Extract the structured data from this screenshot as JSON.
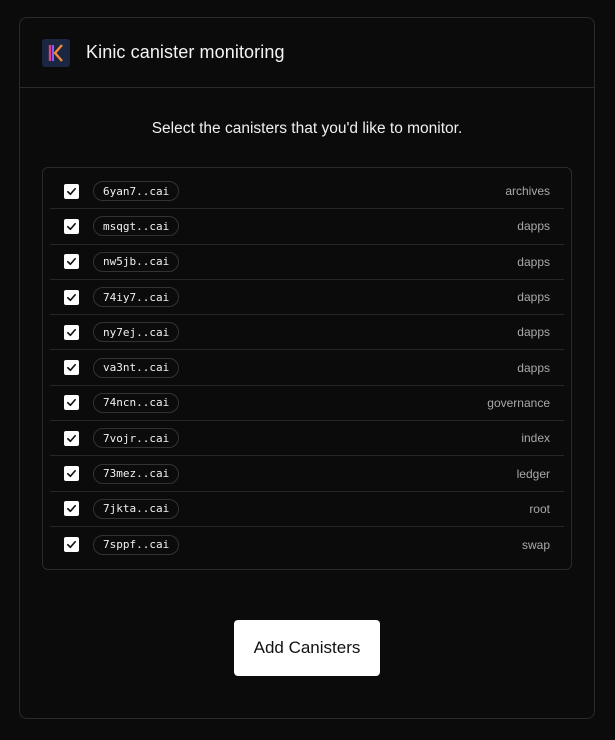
{
  "header": {
    "title": "Kinic canister monitoring",
    "logo_icon": "kinic-logo-icon"
  },
  "instruction": "Select the canisters that you'd like to monitor.",
  "canisters": [
    {
      "id": "6yan7..cai",
      "category": "archives",
      "checked": true
    },
    {
      "id": "msqgt..cai",
      "category": "dapps",
      "checked": true
    },
    {
      "id": "nw5jb..cai",
      "category": "dapps",
      "checked": true
    },
    {
      "id": "74iy7..cai",
      "category": "dapps",
      "checked": true
    },
    {
      "id": "ny7ej..cai",
      "category": "dapps",
      "checked": true
    },
    {
      "id": "va3nt..cai",
      "category": "dapps",
      "checked": true
    },
    {
      "id": "74ncn..cai",
      "category": "governance",
      "checked": true
    },
    {
      "id": "7vojr..cai",
      "category": "index",
      "checked": true
    },
    {
      "id": "73mez..cai",
      "category": "ledger",
      "checked": true
    },
    {
      "id": "7jkta..cai",
      "category": "root",
      "checked": true
    },
    {
      "id": "7sppf..cai",
      "category": "swap",
      "checked": true
    }
  ],
  "actions": {
    "add_label": "Add Canisters"
  },
  "colors": {
    "background": "#0b0b0b",
    "border": "#2b2b2b",
    "button_bg": "#ffffff",
    "muted_text": "#a9a9a9"
  }
}
